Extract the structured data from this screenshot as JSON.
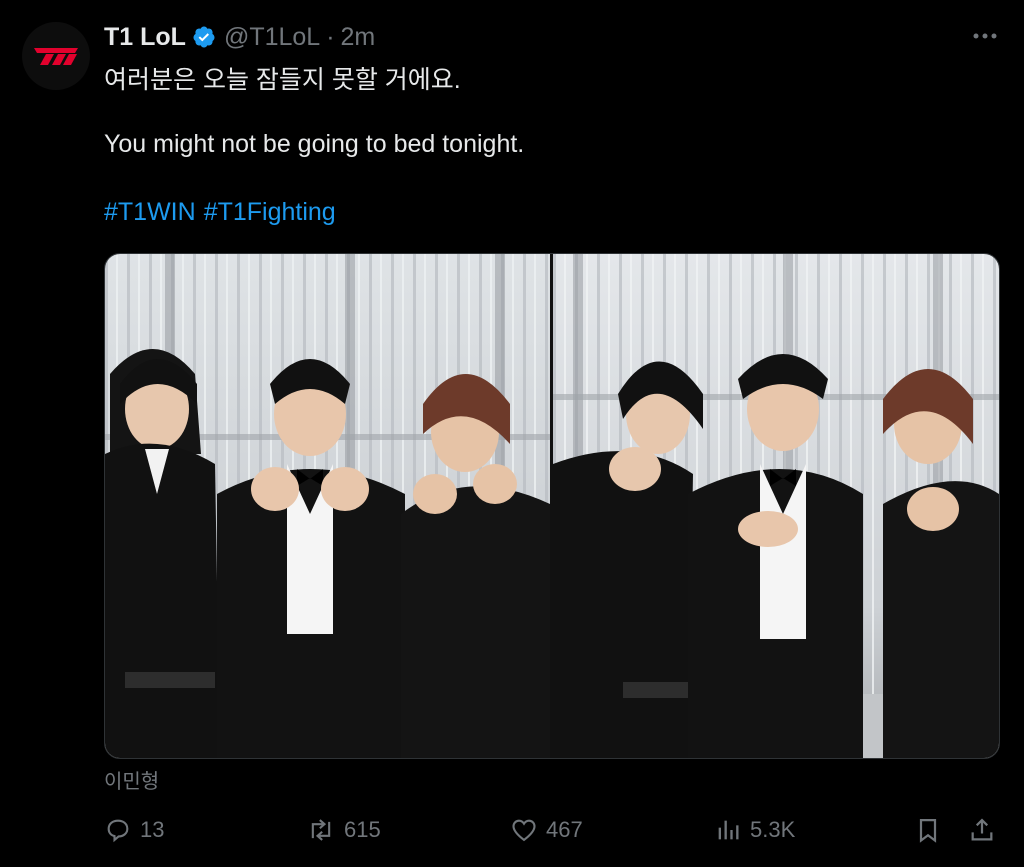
{
  "tweet": {
    "author_name": "T1 LoL",
    "handle": "@T1LoL",
    "separator": "·",
    "time": "2m",
    "lines": [
      "여러분은 오늘 잠들지 못할 거에요.",
      "You might not be going to bed tonight."
    ],
    "hashtags": [
      "#T1WIN",
      "#T1Fighting"
    ],
    "media_caption": "이민형"
  },
  "icons": {
    "avatar": "t1-logo",
    "verified": "verified-badge-icon",
    "more": "more-icon",
    "reply": "reply-icon",
    "repost": "repost-icon",
    "like": "like-icon",
    "views": "views-icon",
    "bookmark": "bookmark-icon",
    "share": "share-icon"
  },
  "actions": {
    "replies": "13",
    "reposts": "615",
    "likes": "467",
    "views": "5.3K"
  },
  "colors": {
    "background": "#000000",
    "text": "#e7e9ea",
    "secondary": "#71767b",
    "accent": "#1d9bf0",
    "brand_red": "#e2012d"
  }
}
